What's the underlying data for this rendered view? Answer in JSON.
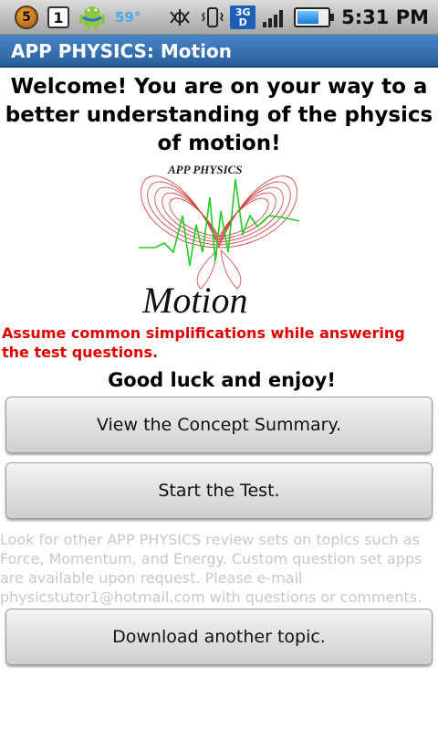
{
  "status_bar": {
    "notification_count": "5",
    "calendar_day": "1",
    "temperature": "59°",
    "network_type": "3G",
    "network_sub": "D",
    "battery_level": 0.7,
    "time": "5:31 PM",
    "icons": [
      "notification-badge-icon",
      "calendar-icon",
      "android-icon",
      "sync-icon",
      "vibrate-icon",
      "3g-icon",
      "signal-icon",
      "battery-icon"
    ]
  },
  "app": {
    "title": "APP PHYSICS: Motion"
  },
  "main": {
    "welcome_text": "Welcome!  You are on your way to a better understanding of the physics of motion!",
    "logo_top_text": "APP PHYSICS",
    "logo_bottom_text": "Motion",
    "warning_text": "Assume common simplifications while answering the test questions.",
    "good_luck_text": "Good luck and enjoy!",
    "concept_button_label": "View the Concept Summary.",
    "test_button_label": "Start the Test.",
    "info_text": " Look for other APP PHYSICS review sets on topics such as Force, Momentum, and Energy. Custom question set apps are available upon request.  Please e-mail physicstutor1@hotmail.com with questions or comments.",
    "download_button_label": "Download another topic."
  },
  "colors": {
    "title_bar": "#2a5f9c",
    "warning": "#e00000",
    "info_text": "#c8c8c8",
    "logo_curve": "#cc2222",
    "logo_signal": "#22cc22"
  }
}
